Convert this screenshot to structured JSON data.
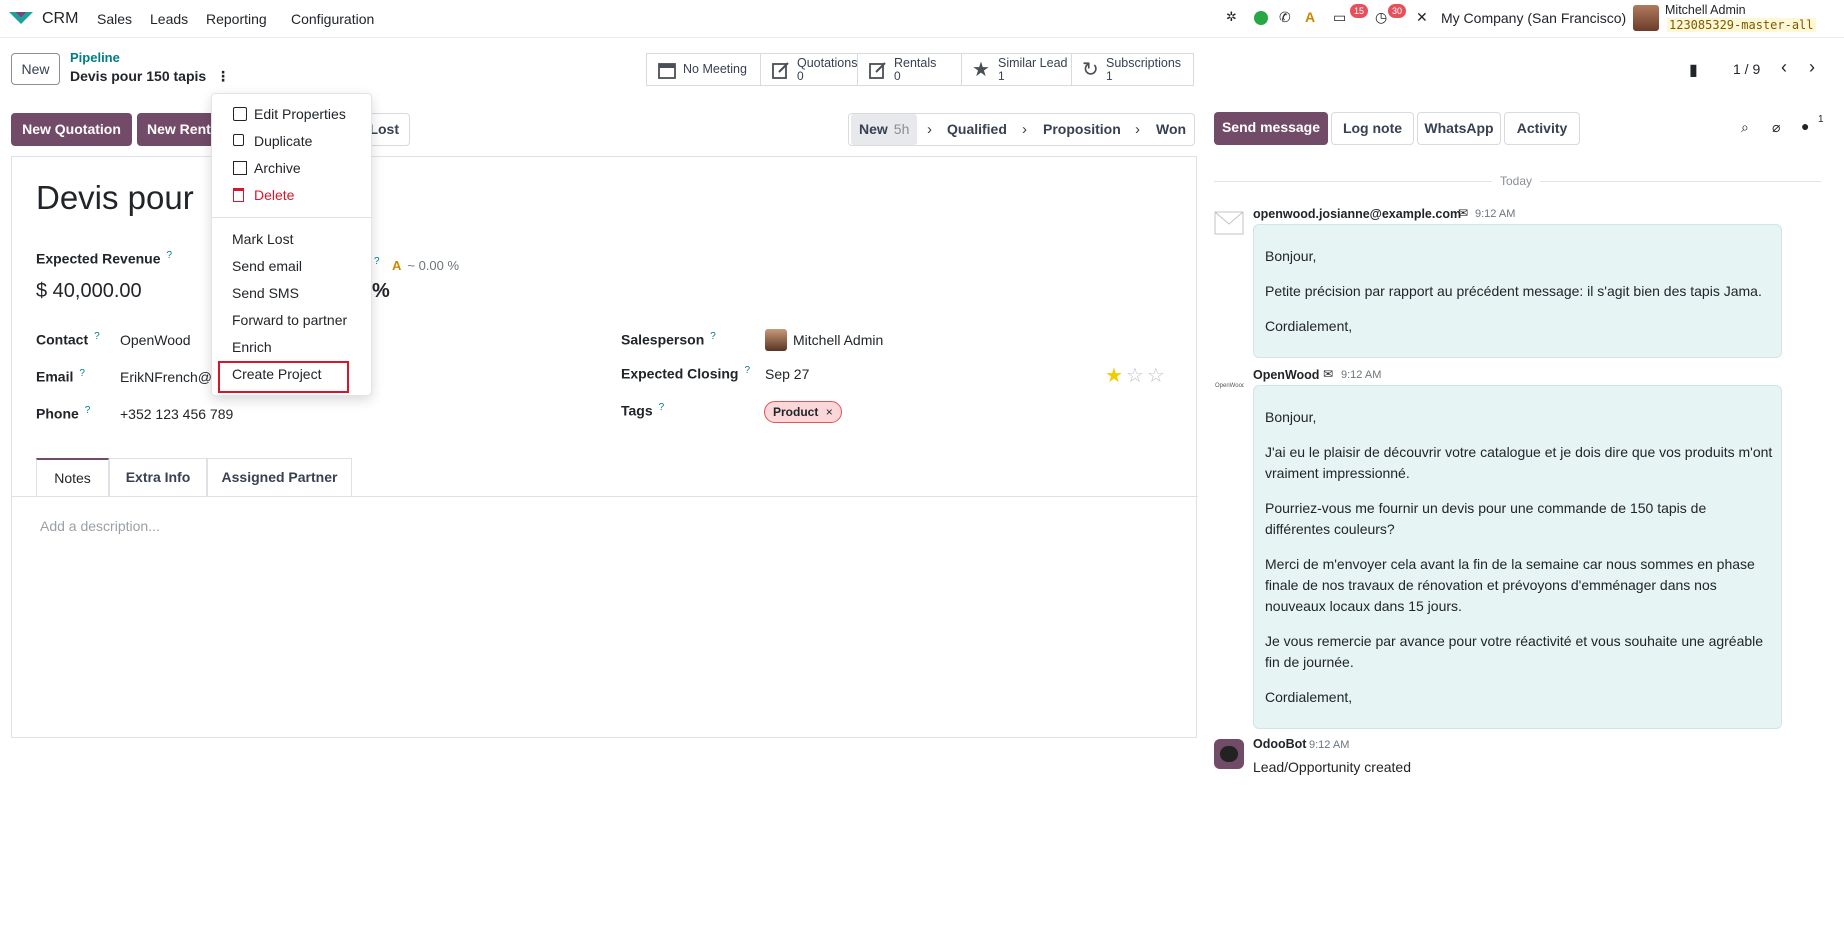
{
  "navbar": {
    "app_name": "CRM",
    "menus": [
      "Sales",
      "Leads",
      "Reporting",
      "Configuration"
    ],
    "messages_count": "15",
    "activities_count": "30",
    "company": "My Company (San Francisco)",
    "user_name": "Mitchell Admin",
    "database": "123085329-master-all"
  },
  "control_panel": {
    "new_label": "New",
    "breadcrumb_parent": "Pipeline",
    "breadcrumb_current": "Devis pour 150 tapis",
    "smart_buttons": [
      {
        "label": "No Meeting",
        "count": "",
        "icon": "calendar-icon"
      },
      {
        "label": "Quotations",
        "count": "0",
        "icon": "edit-icon"
      },
      {
        "label": "Rentals",
        "count": "0",
        "icon": "edit-icon"
      },
      {
        "label": "Similar Lead",
        "count": "1",
        "icon": "star-icon"
      },
      {
        "label": "Subscriptions",
        "count": "1",
        "icon": "refresh-icon"
      }
    ],
    "pager": "1 / 9"
  },
  "actions": {
    "new_quotation": "New Quotation",
    "new_rental": "New Rent",
    "lost": "Lost"
  },
  "stages": {
    "items": [
      "New",
      "Qualified",
      "Proposition",
      "Won"
    ],
    "current_duration": "5h"
  },
  "form": {
    "title": "Devis pour",
    "expected_revenue_label": "Expected Revenue",
    "expected_revenue": "$ 40,000.00",
    "probability_suffix": "%",
    "ai_probability": "~ 0.00 %",
    "contact_label": "Contact",
    "contact": "OpenWood",
    "email_label": "Email",
    "email": "ErikNFrench@",
    "phone_label": "Phone",
    "phone": "+352 123 456 789",
    "salesperson_label": "Salesperson",
    "salesperson": "Mitchell Admin",
    "expected_closing_label": "Expected Closing",
    "expected_closing": "Sep 27",
    "priority_stars": 1,
    "tags_label": "Tags",
    "tag": "Product",
    "tabs": [
      "Notes",
      "Extra Info",
      "Assigned Partner"
    ],
    "description_placeholder": "Add a description..."
  },
  "dropdown": {
    "group1": [
      {
        "label": "Edit Properties",
        "icon": "gear-icon"
      },
      {
        "label": "Duplicate",
        "icon": "copy-icon"
      },
      {
        "label": "Archive",
        "icon": "archive-icon"
      },
      {
        "label": "Delete",
        "icon": "trash-icon"
      }
    ],
    "group2": [
      "Mark Lost",
      "Send email",
      "Send SMS",
      "Forward to partner",
      "Enrich",
      "Create Project"
    ]
  },
  "chatter": {
    "send_message": "Send message",
    "log_note": "Log note",
    "whatsapp": "WhatsApp",
    "activity": "Activity",
    "followers_count": "1",
    "today": "Today",
    "messages": [
      {
        "author": "openwood.josianne@example.com",
        "time": "9:12 AM",
        "lines": [
          "Bonjour,",
          "Petite précision par rapport au précédent message: il s'agit bien des tapis Jama.",
          "Cordialement,"
        ]
      },
      {
        "author": "OpenWood",
        "time": "9:12 AM",
        "lines": [
          "Bonjour,",
          "J'ai eu le plaisir de découvrir votre catalogue et je dois dire que vos produits m'ont vraiment impressionné.",
          "Pourriez-vous me fournir un devis pour une commande de 150 tapis de différentes couleurs?",
          "Merci de m'envoyer cela avant la fin de la semaine car nous sommes en phase finale de nos travaux de rénovation et prévoyons d'emménager dans nos nouveaux locaux dans 15 jours.",
          "Je vous remercie par avance pour votre réactivité et vous souhaite une agréable fin de journée.",
          "Cordialement,"
        ]
      },
      {
        "author": "OdooBot",
        "time": "9:12 AM",
        "text": "Lead/Opportunity created"
      }
    ]
  },
  "colors": {
    "primary": "#714b67",
    "accent": "#017e84",
    "danger": "#d9152c",
    "chatter_bubble": "#e6f4f4"
  }
}
